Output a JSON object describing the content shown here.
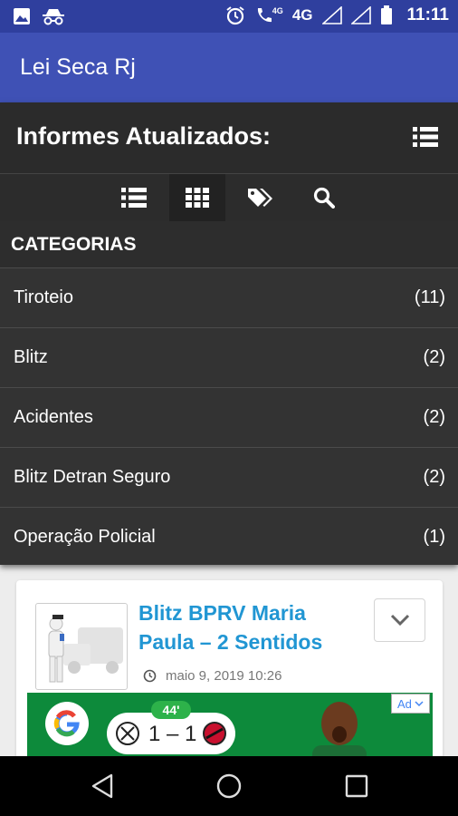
{
  "status_bar": {
    "network": "4G",
    "network_small": "4G",
    "time": "11:11",
    "icons": [
      "image-icon",
      "incognito-icon",
      "alarm-icon",
      "wifi-call-icon",
      "signal-icon",
      "battery-icon"
    ]
  },
  "app": {
    "title": "Lei Seca Rj",
    "accent": "#3f51b5",
    "link_color": "#2196d3"
  },
  "panel": {
    "title": "Informes Atualizados:",
    "tabs": [
      "list-icon",
      "grid-icon",
      "tags-icon",
      "search-icon"
    ],
    "active_tab": "grid-icon",
    "categories_heading": "CATEGORIAS",
    "categories": [
      {
        "name": "Tiroteio",
        "count": "(11)"
      },
      {
        "name": "Blitz",
        "count": "(2)"
      },
      {
        "name": "Acidentes",
        "count": "(2)"
      },
      {
        "name": "Blitz Detran Seguro",
        "count": "(2)"
      },
      {
        "name": "Operação Policial",
        "count": "(1)"
      }
    ]
  },
  "post": {
    "title": "Blitz BPRV Maria Paula – 2 Sentidos",
    "date": "maio 9, 2019 10:26"
  },
  "ad": {
    "badge": "Ad",
    "minute": "44'",
    "score": "1 – 1"
  },
  "navigation": [
    "back-icon",
    "home-icon",
    "recents-icon"
  ]
}
